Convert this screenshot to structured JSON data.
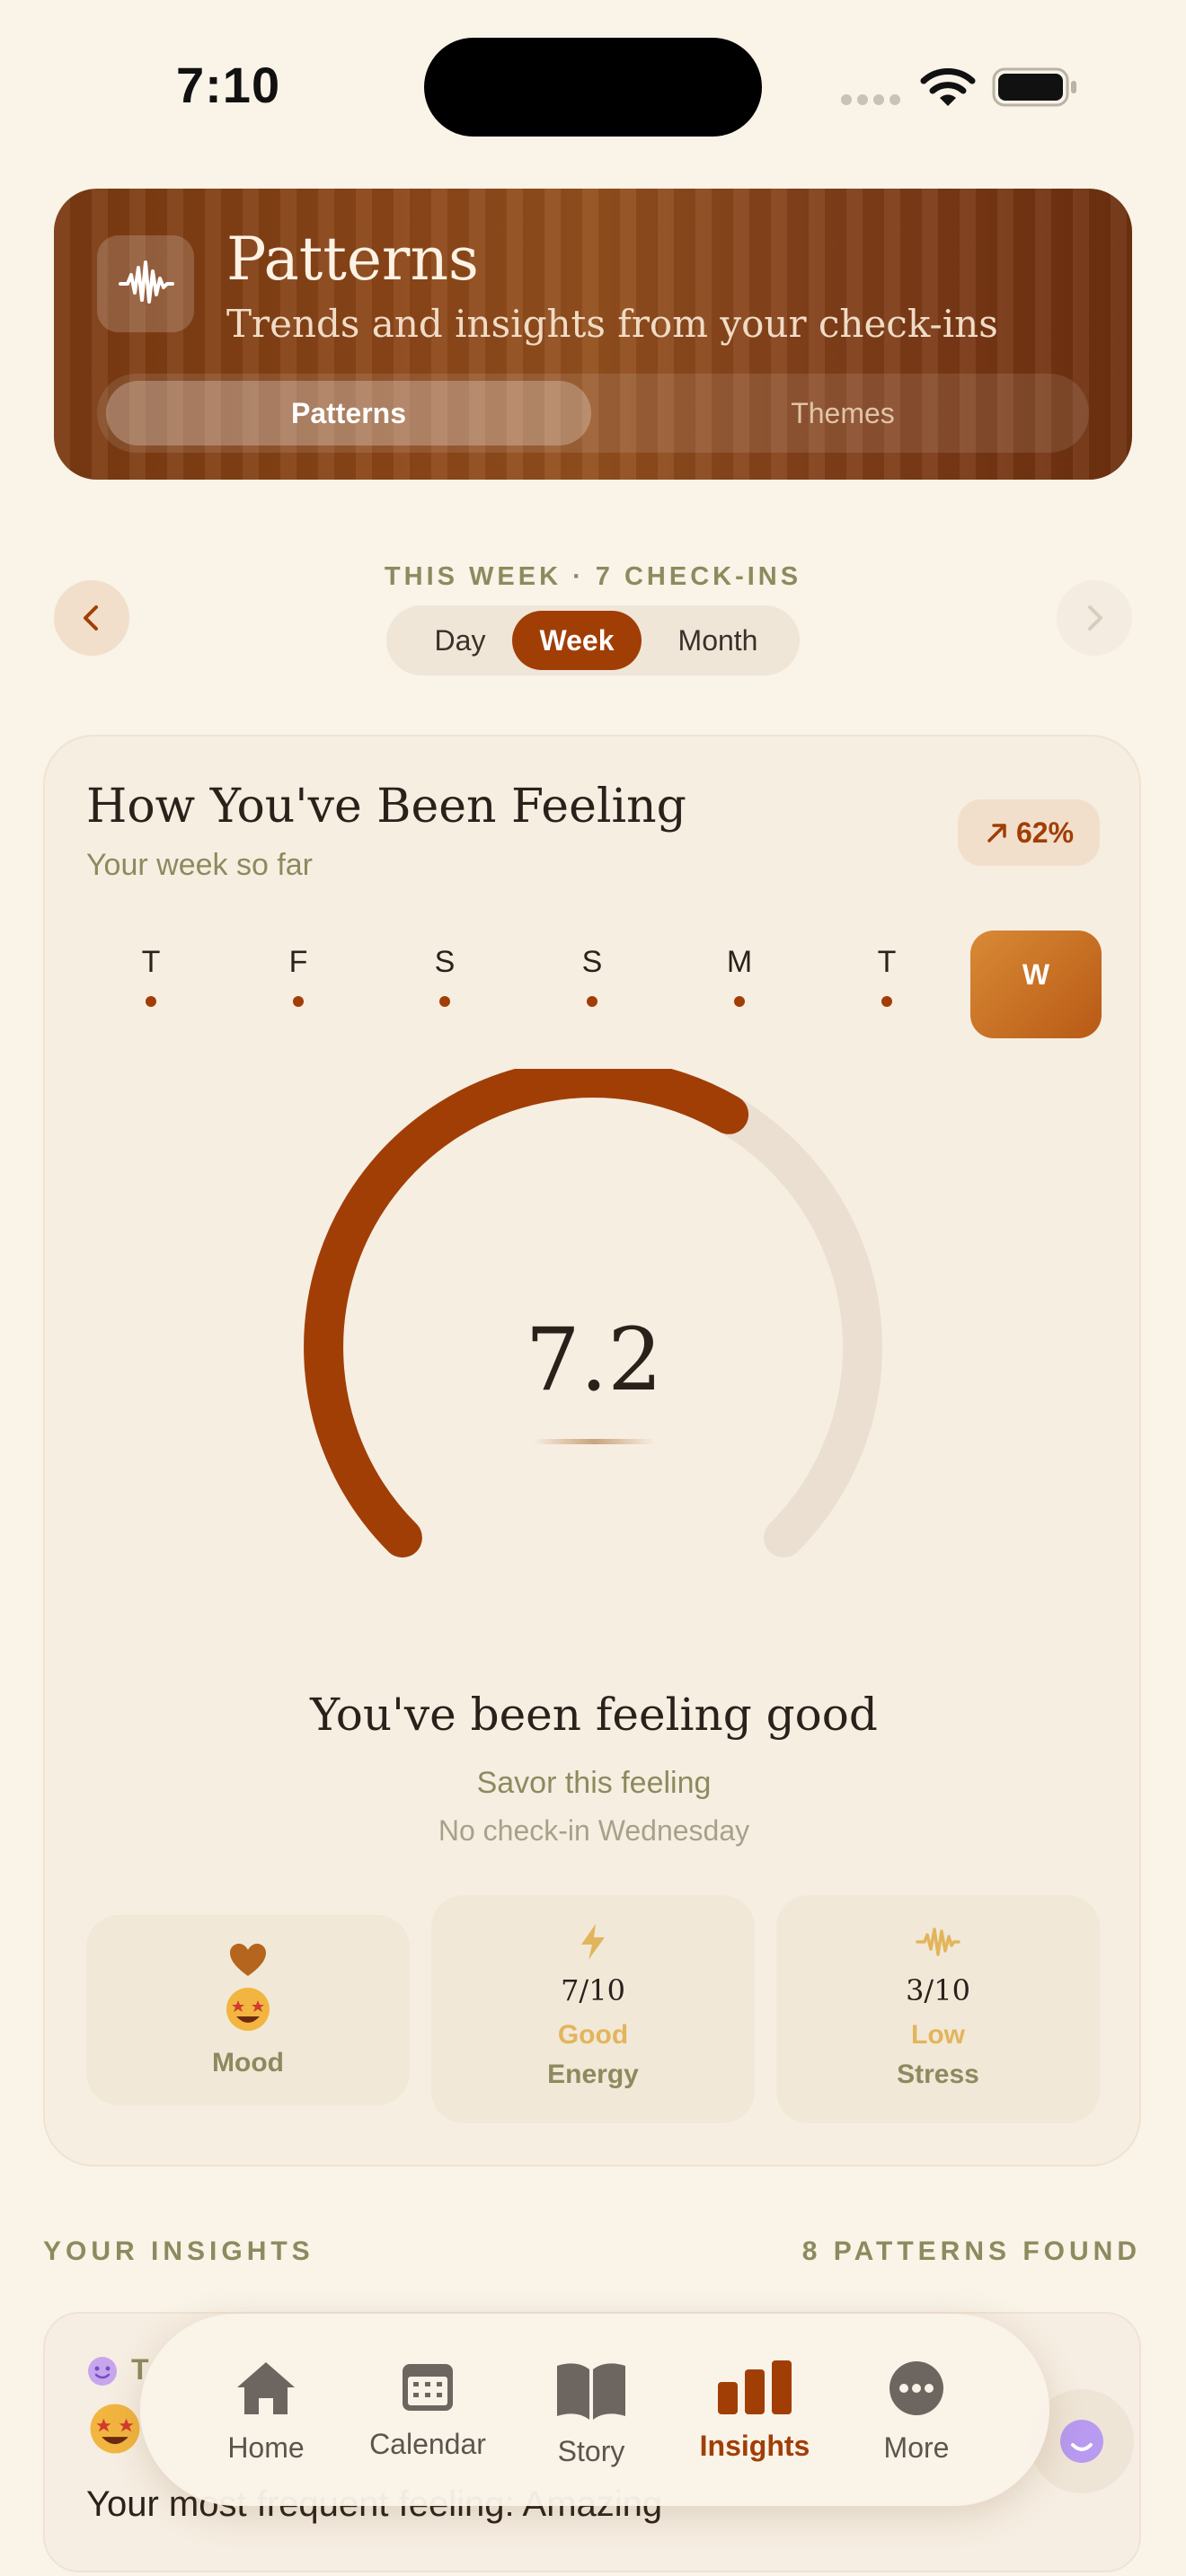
{
  "status_bar": {
    "time": "7:10"
  },
  "header": {
    "title": "Patterns",
    "subtitle": "Trends and insights from your check-ins",
    "segments": [
      {
        "label": "Patterns",
        "active": true
      },
      {
        "label": "Themes",
        "active": false
      }
    ]
  },
  "period": {
    "label": "THIS WEEK · 7 CHECK-INS",
    "tabs": [
      {
        "label": "Day"
      },
      {
        "label": "Week",
        "active": true
      },
      {
        "label": "Month"
      }
    ]
  },
  "feeling": {
    "title": "How You've Been Feeling",
    "subtitle": "Your week so far",
    "trend": "62%",
    "days": [
      {
        "label": "T"
      },
      {
        "label": "F"
      },
      {
        "label": "S"
      },
      {
        "label": "S"
      },
      {
        "label": "M"
      },
      {
        "label": "T"
      },
      {
        "label": "W",
        "selected": true
      }
    ],
    "score": "7.2",
    "score_value": 7.2,
    "score_max": 10,
    "status": "You've been feeling good",
    "hint": "Savor this feeling",
    "note": "No check-in Wednesday",
    "metrics": {
      "mood": {
        "name": "Mood"
      },
      "energy": {
        "value": "7/10",
        "level": "Good",
        "name": "Energy"
      },
      "stress": {
        "value": "3/10",
        "level": "Low",
        "name": "Stress"
      }
    }
  },
  "insights": {
    "title": "YOUR INSIGHTS",
    "count": "8 PATTERNS FOUND",
    "first": {
      "text": "Your most frequent feeling: Amazing",
      "tag": "T"
    }
  },
  "nav": {
    "items": [
      {
        "label": "Home"
      },
      {
        "label": "Calendar"
      },
      {
        "label": "Story"
      },
      {
        "label": "Insights",
        "active": true
      },
      {
        "label": "More"
      }
    ]
  },
  "colors": {
    "accent": "#a13e06",
    "background": "#f9f3e8",
    "muted": "#8d8a5e",
    "energy": "#e2b55c"
  }
}
